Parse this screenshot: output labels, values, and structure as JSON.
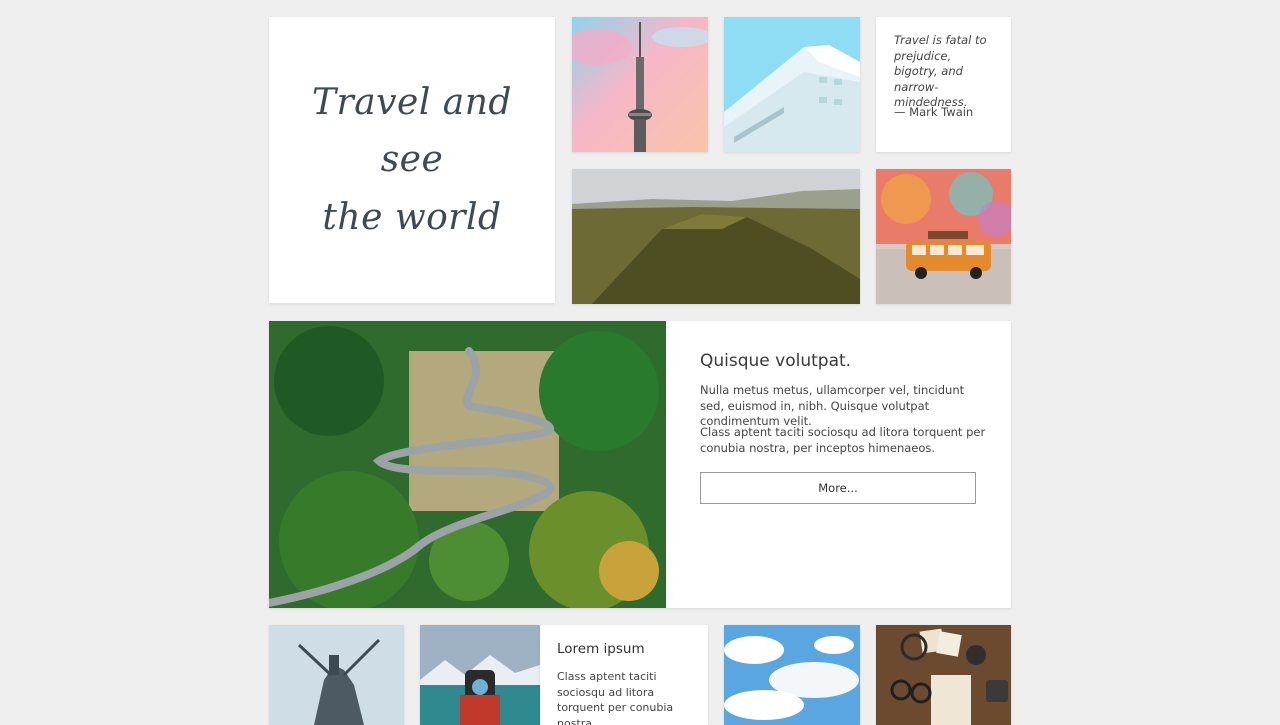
{
  "hero": {
    "title_line1": "Travel and see",
    "title_line2": "the world"
  },
  "quote": {
    "text": "Travel is fatal to prejudice, bigotry, and narrow-mindedness.",
    "author": "— Mark Twain"
  },
  "feature": {
    "heading": "Quisque volutpat.",
    "paragraph1": "Nulla metus metus, ullamcorper vel, tincidunt sed, euismod in, nibh. Quisque volutpat condimentum velit.",
    "paragraph2": "Class aptent taciti sociosqu ad litora torquent per conubia nostra, per inceptos himenaeos.",
    "button_label": "More..."
  },
  "card": {
    "heading": "Lorem ipsum",
    "text": "Class aptent taciti sociosqu ad litora torquent per conubia nostra"
  },
  "colors": {
    "page_bg": "#efefef",
    "tile_bg": "#ffffff",
    "title_ink": "#3d4a54"
  }
}
